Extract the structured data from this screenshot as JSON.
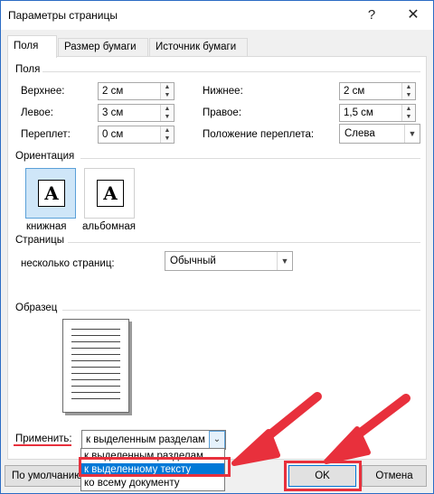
{
  "window": {
    "title": "Параметры страницы",
    "help_glyph": "?",
    "close_glyph": "✕"
  },
  "tabs": [
    {
      "label": "Поля",
      "active": true
    },
    {
      "label": "Размер бумаги",
      "active": false
    },
    {
      "label": "Источник бумаги",
      "active": false
    }
  ],
  "margins": {
    "title": "Поля",
    "top": {
      "label": "Верхнее:",
      "value": "2 см"
    },
    "bottom": {
      "label": "Нижнее:",
      "value": "2 см"
    },
    "left": {
      "label": "Левое:",
      "value": "3 см"
    },
    "right": {
      "label": "Правое:",
      "value": "1,5 см"
    },
    "gutter": {
      "label": "Переплет:",
      "value": "0 см"
    },
    "gutter_position": {
      "label": "Положение переплета:",
      "value": "Слева"
    }
  },
  "orientation": {
    "title": "Ориентация",
    "portrait": {
      "label": "книжная",
      "glyph": "A",
      "selected": true
    },
    "landscape": {
      "label": "альбомная",
      "glyph": "A",
      "selected": false
    }
  },
  "pages": {
    "title": "Страницы",
    "multiple_label": "несколько страниц:",
    "multiple_value": "Обычный"
  },
  "preview": {
    "title": "Образец"
  },
  "apply": {
    "label": "Применить:",
    "value": "к выделенным разделам",
    "options": [
      "к выделенным разделам",
      "к выделенному тексту",
      "ко всему документу"
    ],
    "highlighted_index": 1
  },
  "buttons": {
    "default": "По умолчанию",
    "ok": "OK",
    "cancel": "Отмена"
  },
  "annotation": {
    "color": "#e8303c",
    "arrow_count": 2
  },
  "colors": {
    "highlight": "#0078d7",
    "selection_bg": "#cfe6f8"
  }
}
